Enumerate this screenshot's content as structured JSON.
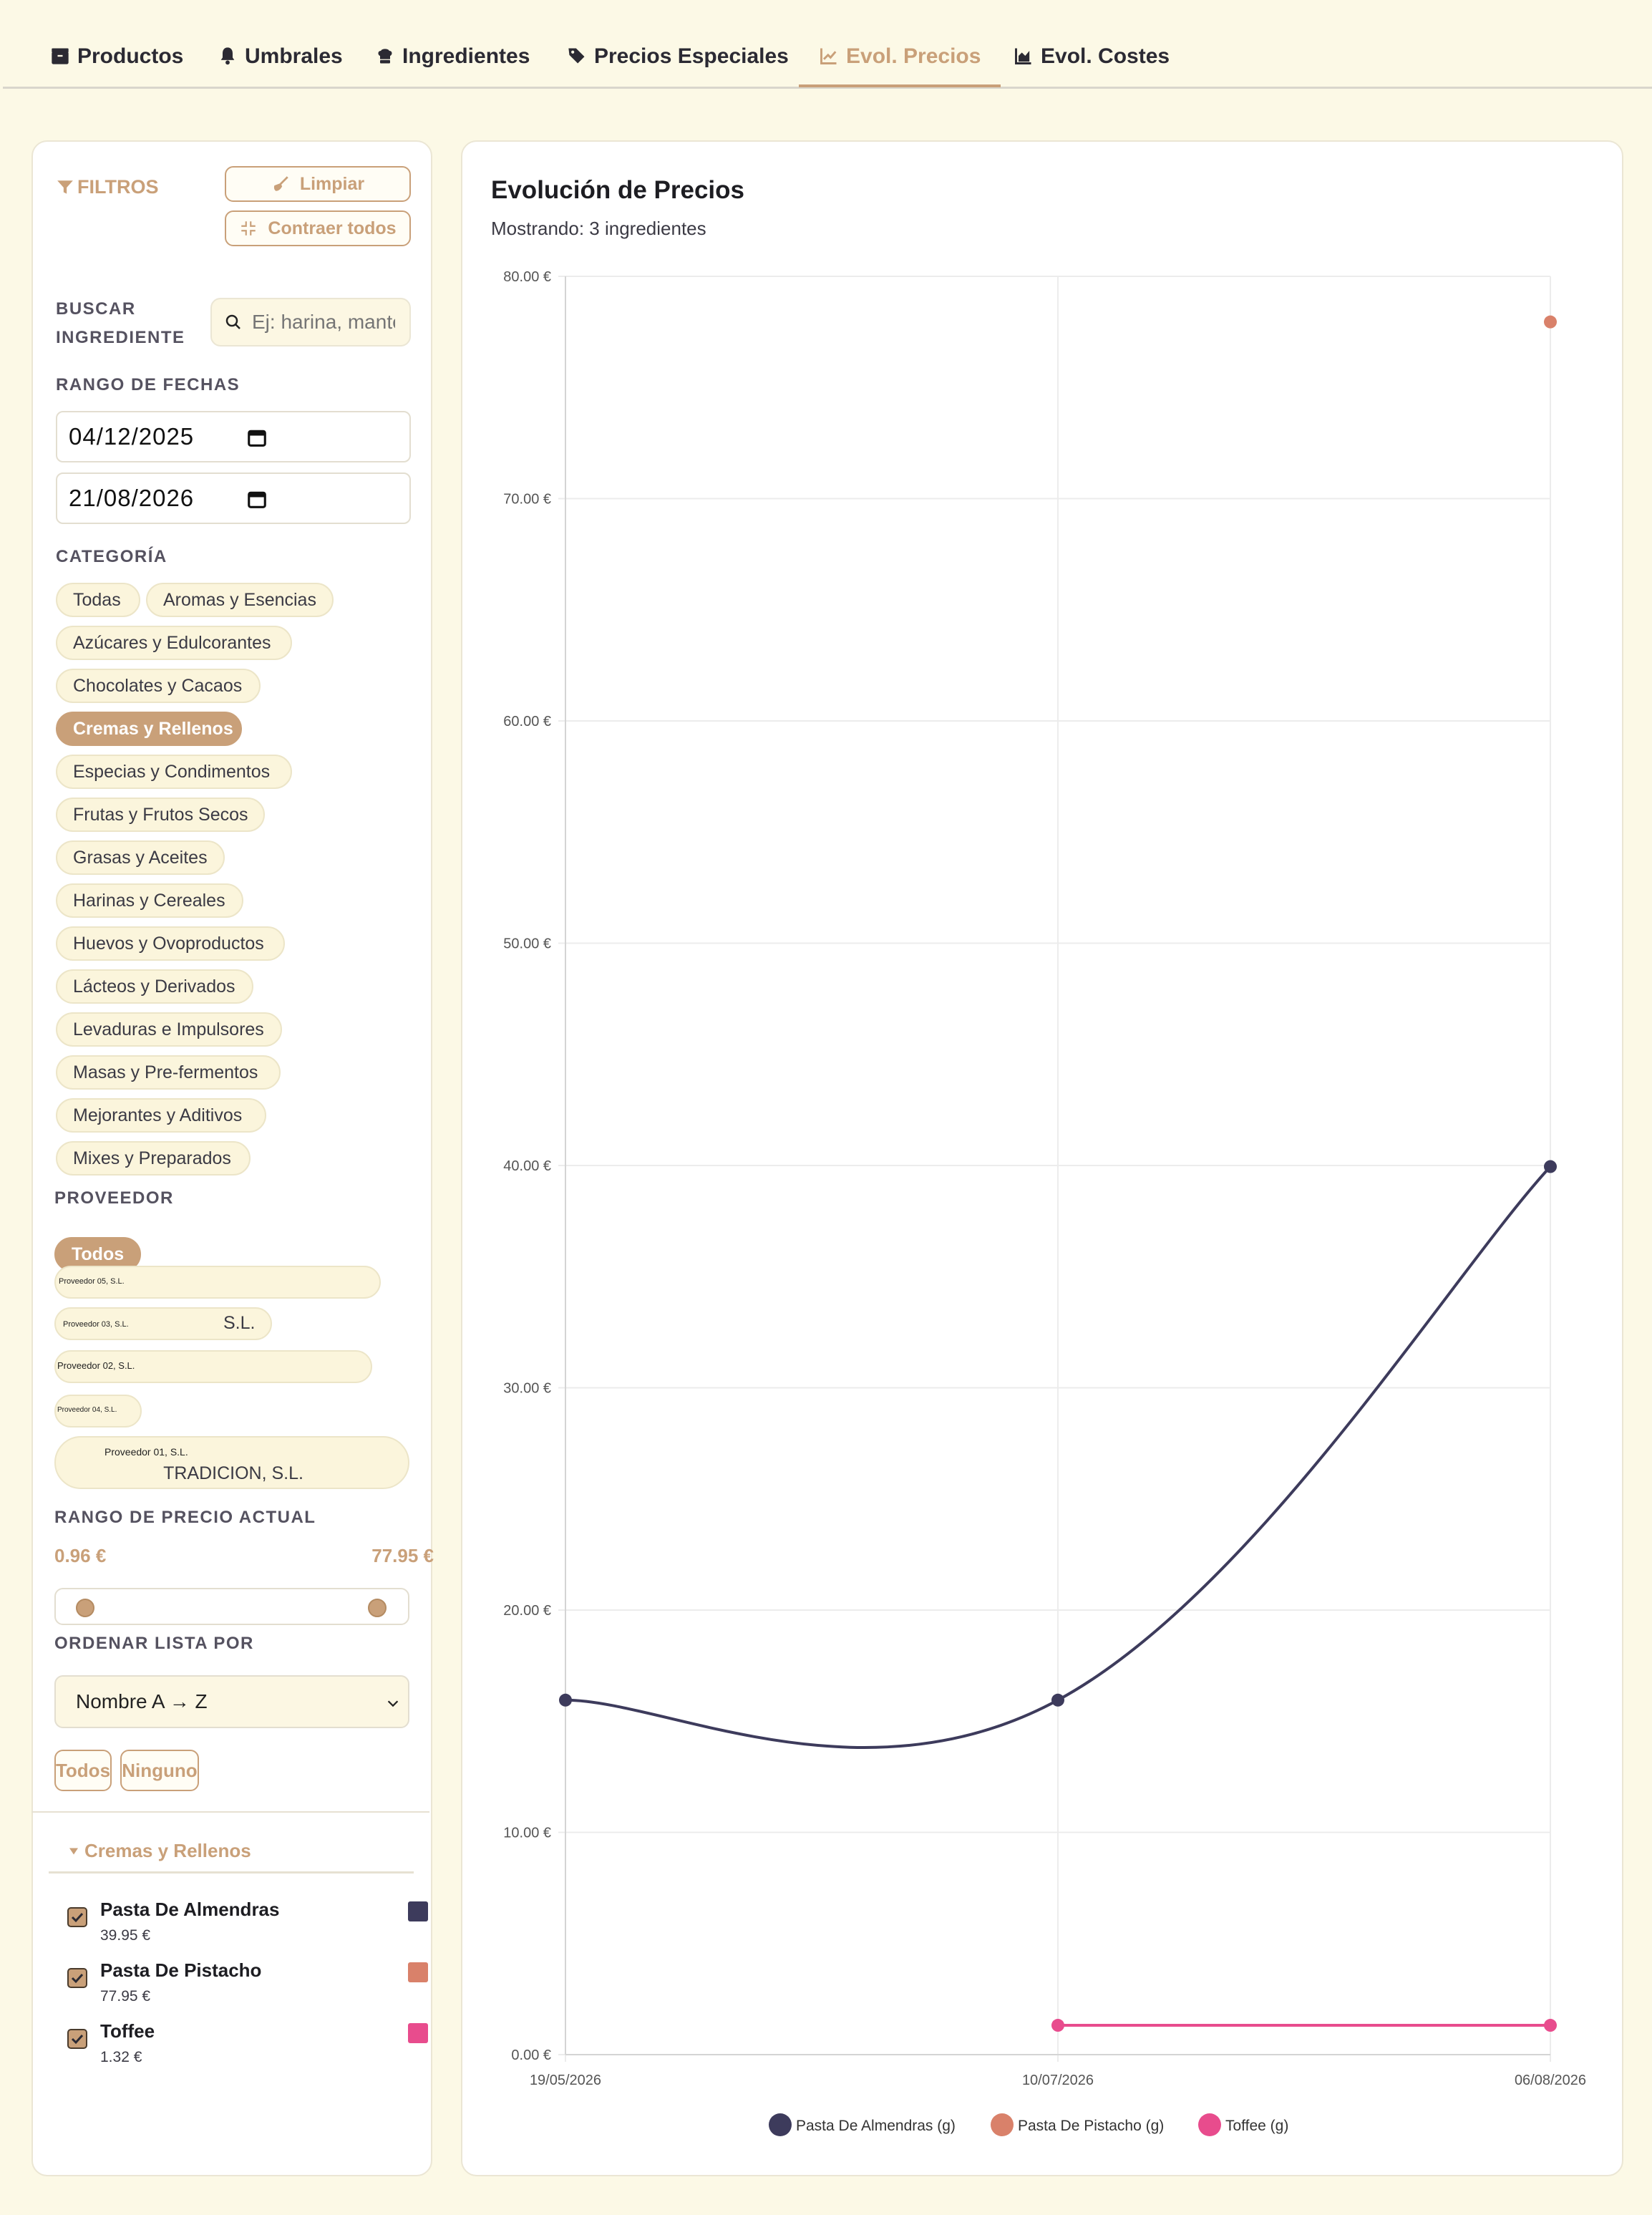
{
  "tabs": [
    {
      "label": "Productos",
      "icon": "box-icon"
    },
    {
      "label": "Umbrales",
      "icon": "bell-icon"
    },
    {
      "label": "Ingredientes",
      "icon": "chef-hat-icon"
    },
    {
      "label": "Precios Especiales",
      "icon": "tags-icon"
    },
    {
      "label": "Evol. Precios",
      "icon": "line-chart-icon"
    },
    {
      "label": "Evol. Costes",
      "icon": "area-chart-icon"
    }
  ],
  "sidebar": {
    "title": "FILTROS",
    "clear_label": "Limpiar",
    "collapse_label": "Contraer todos",
    "search_label_1": "BUSCAR",
    "search_label_2": "INGREDIENTE",
    "search_placeholder": "Ej: harina, mantequilla...",
    "date_label": "RANGO DE FECHAS",
    "date_from": "04/12/2025",
    "date_to": "21/08/2026",
    "category_label": "CATEGORÍA",
    "categories": [
      "Todas",
      "Aromas y Esencias",
      "Azúcares y Edulcorantes",
      "Chocolates y Cacaos",
      "Cremas y Rellenos",
      "Especias y Condimentos",
      "Frutas y Frutos Secos",
      "Grasas y Aceites",
      "Harinas y Cereales",
      "Huevos y Ovoproductos",
      "Lácteos y Derivados",
      "Levaduras e Impulsores",
      "Masas y Pre-fermentos",
      "Mejorantes y Aditivos",
      "Mixes y Preparados"
    ],
    "active_category": "Cremas y Rellenos",
    "supplier_label": "PROVEEDOR",
    "supplier_all": "Todos",
    "suppliers": [
      {
        "tag": "Proveedor 05, S.L.",
        "text": ""
      },
      {
        "tag": "Proveedor 03, S.L.",
        "text": "S.L."
      },
      {
        "tag": "Proveedor 02, S.L.",
        "text": ""
      },
      {
        "tag": "Proveedor 04, S.L.",
        "text": ""
      },
      {
        "tag": "Proveedor 01, S.L.",
        "text": "TRADICION, S.L."
      }
    ],
    "price_range_label": "RANGO DE PRECIO ACTUAL",
    "price_min": "0.96 €",
    "price_max": "77.95 €",
    "sort_label": "ORDENAR LISTA POR",
    "sort_value": "Nombre A → Z",
    "select_all": "Todos",
    "select_none": "Ninguno",
    "group_name": "Cremas y Rellenos",
    "ingredients": [
      {
        "name": "Pasta De Almendras",
        "price": "39.95 €",
        "color": "#3d3b5c",
        "checked": true
      },
      {
        "name": "Pasta De Pistacho",
        "price": "77.95 €",
        "color": "#d9816a",
        "checked": true
      },
      {
        "name": "Toffee",
        "price": "1.32 €",
        "color": "#e84c8d",
        "checked": true
      }
    ]
  },
  "chart": {
    "title": "Evolución de Precios",
    "subtitle": "Mostrando: 3 ingredientes"
  },
  "chart_data": {
    "type": "line",
    "x": [
      "19/05/2026",
      "10/07/2026",
      "06/08/2026"
    ],
    "ylim": [
      0,
      80
    ],
    "yticks": [
      "0.00 €",
      "10.00 €",
      "20.00 €",
      "30.00 €",
      "40.00 €",
      "50.00 €",
      "60.00 €",
      "70.00 €",
      "80.00 €"
    ],
    "grid": true,
    "legend": "bottom",
    "series": [
      {
        "name": "Pasta De Almendras (g)",
        "color": "#3d3b5c",
        "values": [
          15.95,
          15.95,
          39.95
        ]
      },
      {
        "name": "Pasta De Pistacho (g)",
        "color": "#d9816a",
        "values": [
          null,
          null,
          77.95
        ]
      },
      {
        "name": "Toffee (g)",
        "color": "#e84c8d",
        "values": [
          null,
          1.32,
          1.32
        ]
      }
    ]
  }
}
